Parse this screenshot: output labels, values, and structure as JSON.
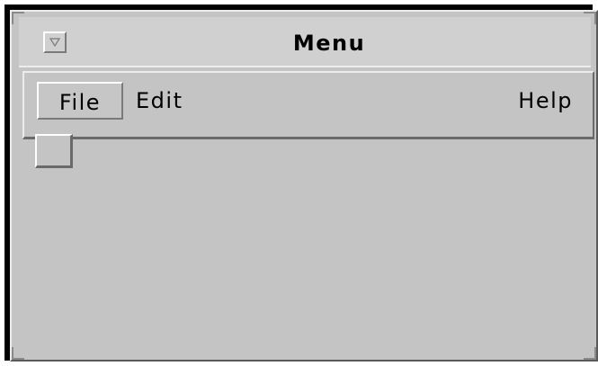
{
  "window": {
    "title": "Menu",
    "menu_button_icon": "triangle-down-icon"
  },
  "menubar": {
    "items": [
      {
        "label": "File"
      },
      {
        "label": "Edit"
      },
      {
        "label": "Help"
      }
    ]
  },
  "colors": {
    "background": "#c4c4c4",
    "titlebar": "#d0d0d0",
    "highlight": "#ececec",
    "shadow": "#6a6a6a",
    "frame_shadow": "#000000"
  }
}
